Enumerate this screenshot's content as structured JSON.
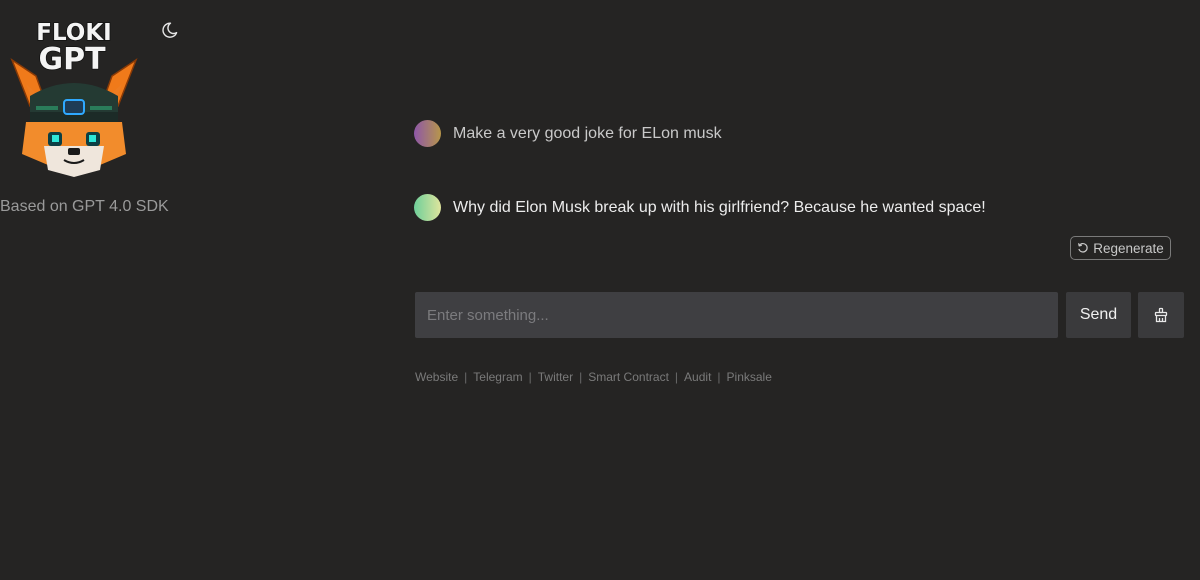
{
  "sidebar": {
    "logo": {
      "line1": "FLOKI",
      "line2": "GPT",
      "icon": "floki-viking-dog-logo"
    },
    "theme_toggle_icon": "moon-icon",
    "tagline": "Based on GPT 4.0 SDK"
  },
  "chat": {
    "messages": [
      {
        "role": "user",
        "text": "Make a very good joke for ELon musk"
      },
      {
        "role": "assistant",
        "text": "Why did Elon Musk break up with his girlfriend? Because he wanted space!"
      }
    ],
    "regenerate_label": "Regenerate",
    "regenerate_icon": "refresh-icon"
  },
  "composer": {
    "placeholder": "Enter something...",
    "value": "",
    "send_label": "Send",
    "clear_icon": "broom-icon"
  },
  "footer": {
    "links": [
      "Website",
      "Telegram",
      "Twitter",
      "Smart Contract",
      "Audit",
      "Pinksale"
    ],
    "separator": "|"
  },
  "colors": {
    "background": "#252423",
    "input_bg": "#3f3f42",
    "button_bg": "#3a3a3c",
    "user_avatar_gradient": [
      "#8e57a8",
      "#b7964a"
    ],
    "bot_avatar_gradient": [
      "#6fcf9a",
      "#dfe59d"
    ]
  }
}
